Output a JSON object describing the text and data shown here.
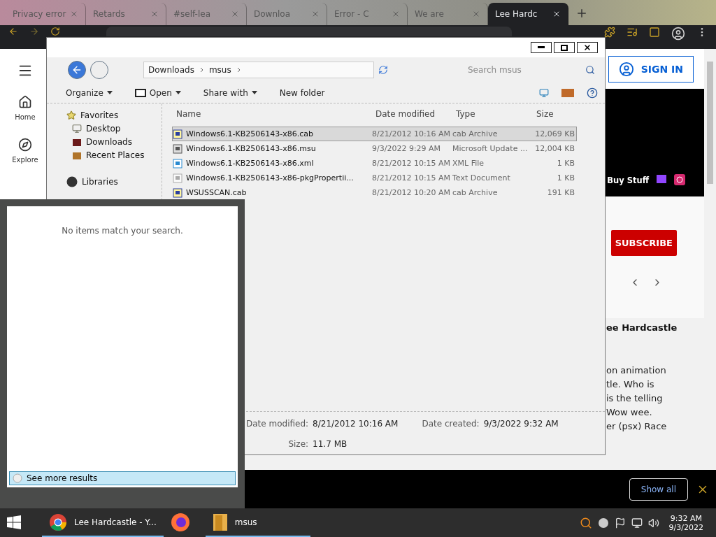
{
  "browser": {
    "tabs": [
      {
        "title": "Privacy error",
        "selected": false
      },
      {
        "title": "Retards",
        "selected": false
      },
      {
        "title": "#self-lea",
        "selected": false
      },
      {
        "title": "Downloa",
        "selected": false
      },
      {
        "title": "Error - C",
        "selected": false
      },
      {
        "title": "We are",
        "selected": false
      },
      {
        "title": "Lee Hardc",
        "selected": true
      }
    ]
  },
  "youtube": {
    "sidebar": [
      {
        "label": "Home",
        "kind": "home"
      },
      {
        "label": "Explore",
        "kind": "explore"
      }
    ],
    "sign_in": "SIGN IN",
    "banner_link": "Buy Stuff",
    "subscribe": "SUBSCRIBE",
    "channel_name": "ee Hardcastle",
    "description": [
      "on animation",
      "tle. Who is",
      "is the telling",
      "Wow wee.",
      "er (psx) Race"
    ]
  },
  "download_bar": {
    "show_all": "Show all"
  },
  "explorer": {
    "breadcrumb": [
      "Downloads",
      "msus"
    ],
    "search": {
      "placeholder": "Search msus"
    },
    "toolbar": [
      {
        "label": "Organize",
        "dropdown": true,
        "kind": "plain"
      },
      {
        "label": "Open",
        "dropdown": true,
        "kind": "archive"
      },
      {
        "label": "Share with",
        "dropdown": true,
        "kind": "plain"
      },
      {
        "label": "New folder",
        "dropdown": false,
        "kind": "plain"
      }
    ],
    "nav": [
      {
        "label": "Favorites",
        "kind": "star"
      },
      {
        "label": "Desktop",
        "kind": "desktop"
      },
      {
        "label": "Downloads",
        "kind": "downloads"
      },
      {
        "label": "Recent Places",
        "kind": "recent"
      },
      {
        "label": "Libraries",
        "kind": "libraries"
      }
    ],
    "columns": [
      "Name",
      "Date modified",
      "Type",
      "Size"
    ],
    "files": [
      {
        "name": "Windows6.1-KB2506143-x86.cab",
        "date": "8/21/2012 10:16 AM",
        "type": "cab Archive",
        "size": "12,069 KB",
        "kind": "cab",
        "selected": true
      },
      {
        "name": "Windows6.1-KB2506143-x86.msu",
        "date": "9/3/2022 9:29 AM",
        "type": "Microsoft Update ...",
        "size": "12,004 KB",
        "kind": "msu",
        "selected": false
      },
      {
        "name": "Windows6.1-KB2506143-x86.xml",
        "date": "8/21/2012 10:15 AM",
        "type": "XML File",
        "size": "1 KB",
        "kind": "xml",
        "selected": false
      },
      {
        "name": "Windows6.1-KB2506143-x86-pkgPropertii...",
        "date": "8/21/2012 10:15 AM",
        "type": "Text Document",
        "size": "1 KB",
        "kind": "txt",
        "selected": false
      },
      {
        "name": "WSUSSCAN.cab",
        "date": "8/21/2012 10:20 AM",
        "type": "cab Archive",
        "size": "191 KB",
        "kind": "cab",
        "selected": false
      }
    ],
    "details": [
      {
        "label": "Date modified:",
        "value": "8/21/2012 10:16 AM"
      },
      {
        "label": "Date created:",
        "value": "9/3/2022 9:32 AM"
      },
      {
        "label": "Size:",
        "value": "11.7 MB"
      }
    ]
  },
  "start_search": {
    "message": "No items match your search.",
    "more": "See more results"
  },
  "taskbar": {
    "items": [
      {
        "label": "Lee Hardcastle - Y...",
        "kind": "chrome",
        "open": true
      },
      {
        "kind": "firefox",
        "open": false
      },
      {
        "label": "msus",
        "kind": "folder",
        "open": true
      }
    ],
    "clock": {
      "time": "9:32 AM",
      "date": "9/3/2022"
    }
  }
}
